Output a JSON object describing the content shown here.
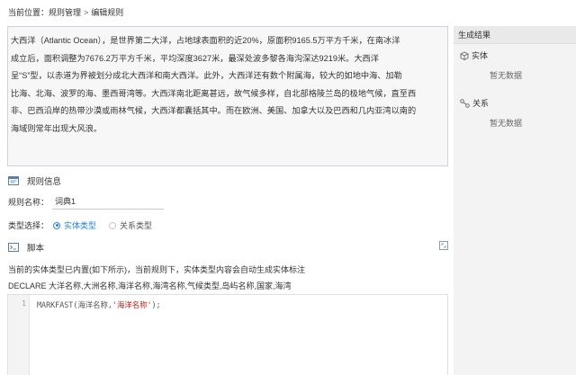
{
  "breadcrumb": {
    "prefix": "当前位置：",
    "items": [
      "规则管理",
      "编辑规则"
    ],
    "separator": ">"
  },
  "text_content": {
    "lines": [
      "大西洋（Atlantic Ocean），是世界第二大洋，占地球表面积的近20%，原面积9165.5万平方千米，在南冰洋",
      "成立后，面积调整为7676.2万平方千米，平均深度3627米，最深处波多黎各海沟深达9219米。大西洋",
      "呈“S”型，以赤道为界被划分成北大西洋和南大西洋。此外，大西洋还有数个附属海，较大的如地中海、加勒",
      "比海、北海、波罗的海、墨西哥湾等。大西洋南北距离甚远，故气候多样，自北部格陵兰岛的极地气候，直至西",
      "非、巴西沿岸的热带沙漠或雨林气候，大西洋都囊括其中。而在欧洲、美国、加拿大以及巴西和几内亚湾以南的",
      "海域则常年出现大风浪。"
    ]
  },
  "rule_info": {
    "title": "规则信息",
    "name_label": "规则名称：",
    "name_value": "词典1"
  },
  "type_select": {
    "label": "类型选择：",
    "options": [
      {
        "label": "实体类型",
        "selected": true
      },
      {
        "label": "关系类型",
        "selected": false
      }
    ]
  },
  "script": {
    "title": "脚本",
    "description_1": "当前的实体类型已内置(如下所示)，当前规则下，实体类型内容会自动生成实体标注",
    "description_2": "DECLARE 大洋名称,大洲名称,海洋名称,海湾名称,气候类型,岛屿名称,国家,海湾",
    "code_line_number": "1",
    "code_fn": "MARKFAST(海洋名称,",
    "code_str": "'海洋名称'",
    "code_end": ");"
  },
  "results_panel": {
    "title": "生成结果",
    "entity_label": "实体",
    "entity_empty": "暂无数据",
    "relation_label": "关系",
    "relation_empty": "暂无数据"
  },
  "colors": {
    "accent": "#2a82e4",
    "textbox_bg": "#f7f7f7",
    "panel_bg": "#f3f3f3",
    "code_string": "#c41a16"
  },
  "icons": {
    "rule_info": "card-icon",
    "script": "terminal-icon",
    "expand": "expand-icon",
    "entity": "cube-icon",
    "relation": "relation-icon"
  }
}
